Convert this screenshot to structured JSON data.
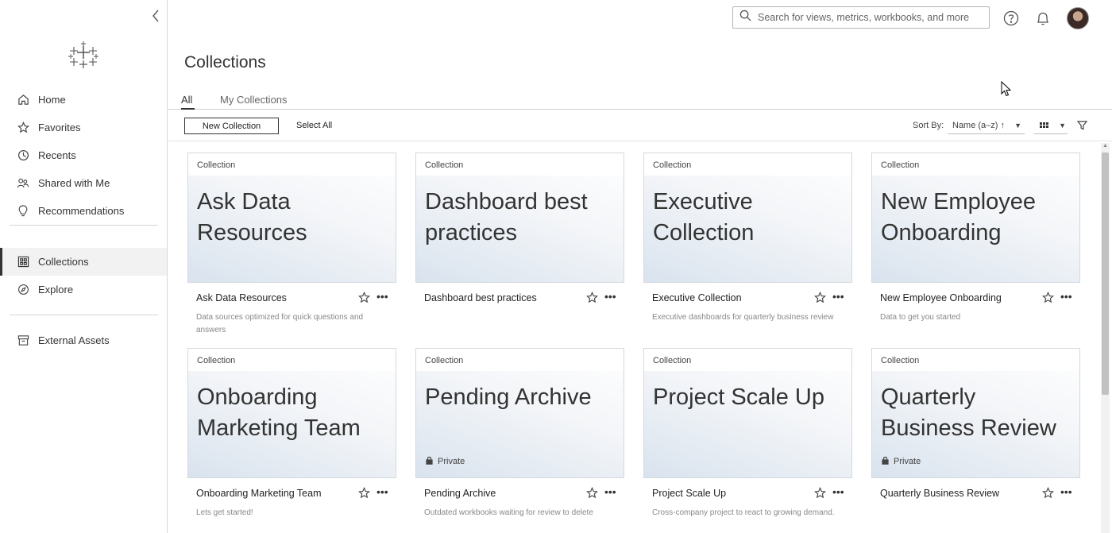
{
  "sidebar": {
    "items": [
      {
        "label": "Home",
        "icon": "home-icon"
      },
      {
        "label": "Favorites",
        "icon": "star-icon"
      },
      {
        "label": "Recents",
        "icon": "clock-icon"
      },
      {
        "label": "Shared with Me",
        "icon": "users-icon"
      },
      {
        "label": "Recommendations",
        "icon": "lightbulb-icon"
      }
    ],
    "items2": [
      {
        "label": "Collections",
        "icon": "collections-icon",
        "active": true
      },
      {
        "label": "Explore",
        "icon": "compass-icon"
      }
    ],
    "items3": [
      {
        "label": "External Assets",
        "icon": "archive-icon"
      }
    ]
  },
  "search": {
    "placeholder": "Search for views, metrics, workbooks, and more"
  },
  "header": {
    "title": "Collections"
  },
  "tabs": [
    {
      "label": "All",
      "active": true
    },
    {
      "label": "My Collections"
    }
  ],
  "toolbar": {
    "new_label": "New Collection",
    "select_all_label": "Select All",
    "sort_label": "Sort By:",
    "sort_value": "Name (a–z) ↑"
  },
  "cards": [
    {
      "kind": "Collection",
      "title": "Ask Data Resources",
      "name": "Ask Data Resources",
      "desc": "Data sources optimized for quick questions and answers",
      "private": ""
    },
    {
      "kind": "Collection",
      "title": "Dashboard best practices",
      "name": "Dashboard best practices",
      "desc": "",
      "private": ""
    },
    {
      "kind": "Collection",
      "title": "Executive Collection",
      "name": "Executive Collection",
      "desc": "Executive dashboards for quarterly business review",
      "private": ""
    },
    {
      "kind": "Collection",
      "title": "New Employee Onboarding",
      "name": "New Employee Onboarding",
      "desc": "Data to get you started",
      "private": ""
    },
    {
      "kind": "Collection",
      "title": "Onboarding Marketing Team",
      "name": "Onboarding Marketing Team",
      "desc": "Lets get started!",
      "private": ""
    },
    {
      "kind": "Collection",
      "title": "Pending Archive",
      "name": "Pending Archive",
      "desc": "Outdated workbooks waiting for review to delete",
      "private": "Private"
    },
    {
      "kind": "Collection",
      "title": "Project Scale Up",
      "name": "Project Scale Up",
      "desc": "Cross-company project to react to growing demand.",
      "private": ""
    },
    {
      "kind": "Collection",
      "title": "Quarterly Business Review",
      "name": "Quarterly Business Review",
      "desc": "",
      "private": "Private"
    }
  ],
  "colors": {
    "accent": "#333333",
    "thumb_gradient_end": "#d9e3ee"
  }
}
